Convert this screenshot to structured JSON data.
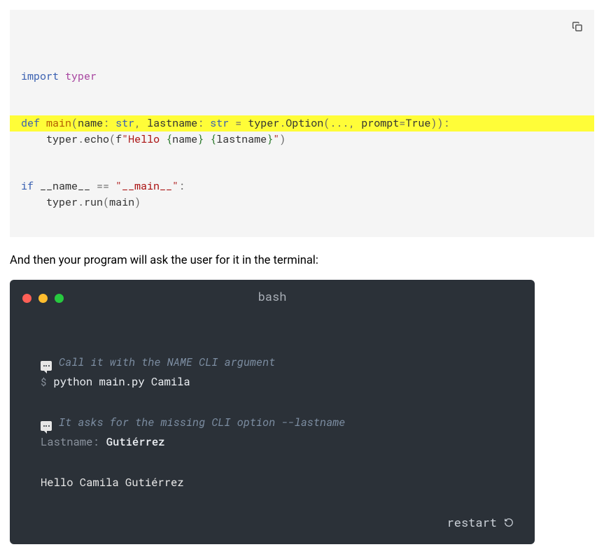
{
  "python_code": {
    "tokens": [
      {
        "line": 0,
        "cls": "tok-kw",
        "t": "import"
      },
      {
        "line": 0,
        "cls": "tok-plain",
        "t": " "
      },
      {
        "line": 0,
        "cls": "tok-mod",
        "t": "typer"
      },
      {
        "line": 3,
        "hl": true,
        "cls": "tok-kw",
        "t": "def"
      },
      {
        "line": 3,
        "cls": "tok-plain",
        "t": " "
      },
      {
        "line": 3,
        "cls": "tok-fn",
        "t": "main"
      },
      {
        "line": 3,
        "cls": "tok-op",
        "t": "("
      },
      {
        "line": 3,
        "cls": "tok-plain",
        "t": "name"
      },
      {
        "line": 3,
        "cls": "tok-op",
        "t": ": "
      },
      {
        "line": 3,
        "cls": "tok-builtin",
        "t": "str"
      },
      {
        "line": 3,
        "cls": "tok-op",
        "t": ", "
      },
      {
        "line": 3,
        "cls": "tok-plain",
        "t": "lastname"
      },
      {
        "line": 3,
        "cls": "tok-op",
        "t": ": "
      },
      {
        "line": 3,
        "cls": "tok-builtin",
        "t": "str"
      },
      {
        "line": 3,
        "cls": "tok-op",
        "t": " = "
      },
      {
        "line": 3,
        "cls": "tok-plain",
        "t": "typer"
      },
      {
        "line": 3,
        "cls": "tok-op",
        "t": "."
      },
      {
        "line": 3,
        "cls": "tok-plain",
        "t": "Option"
      },
      {
        "line": 3,
        "cls": "tok-op",
        "t": "("
      },
      {
        "line": 3,
        "cls": "tok-op",
        "t": "..."
      },
      {
        "line": 3,
        "cls": "tok-op",
        "t": ", "
      },
      {
        "line": 3,
        "cls": "tok-plain",
        "t": "prompt"
      },
      {
        "line": 3,
        "cls": "tok-op",
        "t": "="
      },
      {
        "line": 3,
        "cls": "tok-plain",
        "t": "True"
      },
      {
        "line": 3,
        "cls": "tok-op",
        "t": "))"
      },
      {
        "line": 3,
        "cls": "tok-op",
        "t": ":"
      },
      {
        "line": 4,
        "cls": "tok-plain",
        "t": "    typer"
      },
      {
        "line": 4,
        "cls": "tok-op",
        "t": "."
      },
      {
        "line": 4,
        "cls": "tok-plain",
        "t": "echo"
      },
      {
        "line": 4,
        "cls": "tok-op",
        "t": "("
      },
      {
        "line": 4,
        "cls": "tok-plain",
        "t": "f"
      },
      {
        "line": 4,
        "cls": "tok-str",
        "t": "\"Hello "
      },
      {
        "line": 4,
        "cls": "tok-sub",
        "t": "{"
      },
      {
        "line": 4,
        "cls": "tok-plain",
        "t": "name"
      },
      {
        "line": 4,
        "cls": "tok-sub",
        "t": "}"
      },
      {
        "line": 4,
        "cls": "tok-str",
        "t": " "
      },
      {
        "line": 4,
        "cls": "tok-sub",
        "t": "{"
      },
      {
        "line": 4,
        "cls": "tok-plain",
        "t": "lastname"
      },
      {
        "line": 4,
        "cls": "tok-sub",
        "t": "}"
      },
      {
        "line": 4,
        "cls": "tok-str",
        "t": "\""
      },
      {
        "line": 4,
        "cls": "tok-op",
        "t": ")"
      },
      {
        "line": 7,
        "cls": "tok-kw",
        "t": "if"
      },
      {
        "line": 7,
        "cls": "tok-plain",
        "t": " __name__ "
      },
      {
        "line": 7,
        "cls": "tok-op",
        "t": "== "
      },
      {
        "line": 7,
        "cls": "tok-str",
        "t": "\"__main__\""
      },
      {
        "line": 7,
        "cls": "tok-op",
        "t": ":"
      },
      {
        "line": 8,
        "cls": "tok-plain",
        "t": "    typer"
      },
      {
        "line": 8,
        "cls": "tok-op",
        "t": "."
      },
      {
        "line": 8,
        "cls": "tok-plain",
        "t": "run"
      },
      {
        "line": 8,
        "cls": "tok-op",
        "t": "("
      },
      {
        "line": 8,
        "cls": "tok-plain",
        "t": "main"
      },
      {
        "line": 8,
        "cls": "tok-op",
        "t": ")"
      }
    ],
    "line_count": 9,
    "highlight_lines": [
      3
    ]
  },
  "prose": {
    "after_code": "And then your program will ask the user for it in the terminal:"
  },
  "terminal": {
    "title": "bash",
    "comment1": "Call it with the NAME CLI argument",
    "prompt1": "$",
    "cmd1": "python main.py Camila",
    "comment2": "It asks for the missing CLI option --lastname",
    "prompt_label": "Lastname: ",
    "user_input": "Gutiérrez",
    "output": "Hello Camila Gutiérrez",
    "restart_label": "restart"
  }
}
